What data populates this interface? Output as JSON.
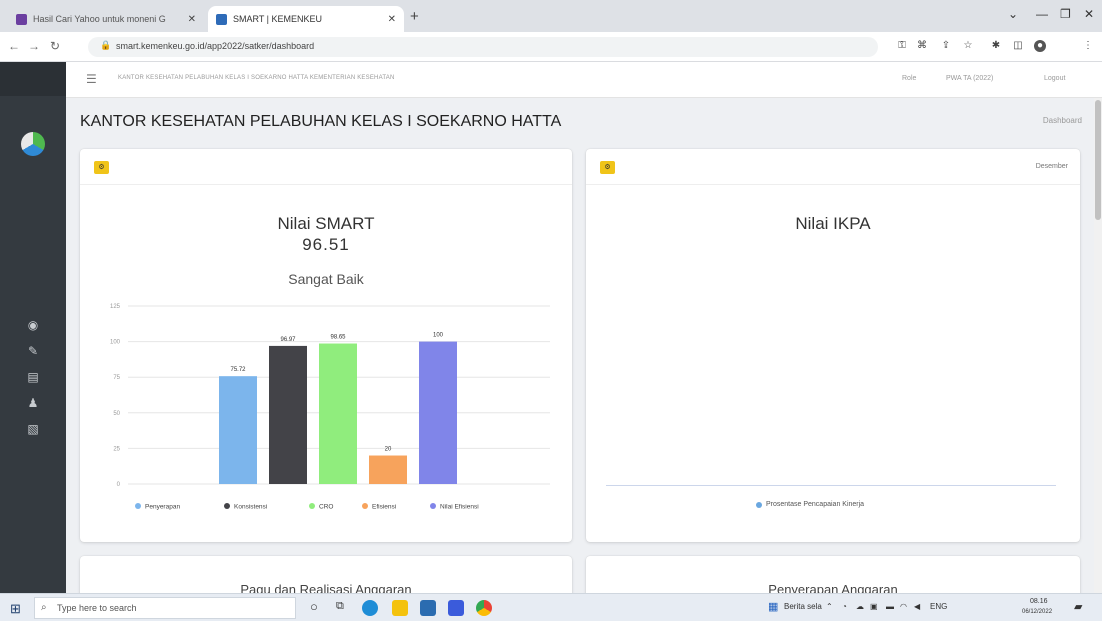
{
  "browser": {
    "tabs": [
      {
        "label": "Hasil Cari Yahoo untuk moneni G",
        "active": false,
        "favicon_color": "#6b3fa0"
      },
      {
        "label": "SMART | KEMENKEU",
        "active": true,
        "favicon_color": "#2e6bb8"
      }
    ],
    "new_tab_label": "+",
    "url": "smart.kemenkeu.go.id/app2022/satker/dashboard",
    "window_controls": [
      "⌄",
      "—",
      "❐",
      "✕"
    ]
  },
  "navbar": {
    "title": "KANTOR KESEHATAN PELABUHAN KELAS I SOEKARNO HATTA KEMENTERIAN KESEHATAN",
    "role_label": "Role",
    "period_label": "PWA TA (2022)",
    "logout_label": "Logout"
  },
  "page": {
    "title": "KANTOR KESEHATAN PELABUHAN KELAS I SOEKARNO HATTA",
    "breadcrumb": "Dashboard"
  },
  "smart_card": {
    "badge": "⚙",
    "title": "Nilai SMART",
    "score": "96.51",
    "category": "Sangat Baik"
  },
  "ikpa_card": {
    "badge": "⚙",
    "title": "Nilai IKPA",
    "month": "Desember",
    "legend": "Prosentase Pencapaian Kinerja",
    "legend_color": "#6aa7e0"
  },
  "bottom_cards": {
    "left_title": "Pagu dan Realisasi Anggaran",
    "right_title": "Penyerapan Anggaran"
  },
  "chart_data": {
    "type": "bar",
    "categories": [
      "Penyerapan",
      "Konsistensi",
      "CRO",
      "Efisiensi",
      "Nilai Efisiensi"
    ],
    "values": [
      75.72,
      96.97,
      98.65,
      20,
      100
    ],
    "value_labels": [
      "75.72",
      "96.97",
      "98.65",
      "20",
      "100"
    ],
    "colors": [
      "#7cb5ec",
      "#434348",
      "#90ed7d",
      "#f7a35c",
      "#8085e9"
    ],
    "ylim": [
      0,
      125
    ],
    "yticks": [
      0,
      25,
      50,
      75,
      100,
      125
    ],
    "grid": true,
    "legend_position": "bottom"
  },
  "taskbar": {
    "search_placeholder": "Type here to search",
    "weather": "Berita sela",
    "language": "ENG",
    "time": "08.16",
    "date": "06/12/2022"
  }
}
